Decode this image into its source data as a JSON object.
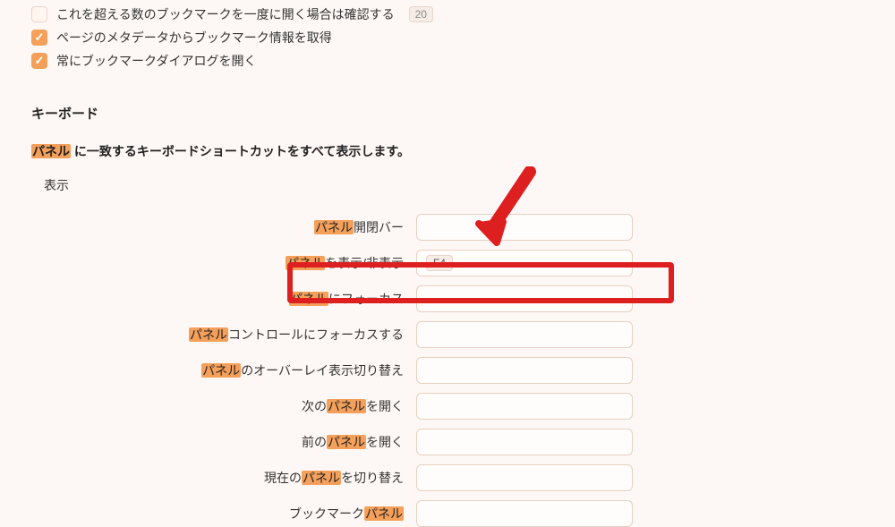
{
  "checkboxes": {
    "confirm_open": {
      "label": "これを超える数のブックマークを一度に開く場合は確認する",
      "value": "20",
      "checked": false
    },
    "metadata": {
      "label": "ページのメタデータからブックマーク情報を取得",
      "checked": true
    },
    "always_dialog": {
      "label": "常にブックマークダイアログを開く",
      "checked": true
    }
  },
  "section_keyboard": "キーボード",
  "filter": {
    "highlight": "パネル",
    "suffix": " に一致するキーボードショートカットをすべて表示します。"
  },
  "subsection_display": "表示",
  "shortcuts": [
    {
      "hl": "パネル",
      "suffix": "開閉バー",
      "key": ""
    },
    {
      "hl": "パネル",
      "suffix": "を表示/非表示",
      "key": "F4"
    },
    {
      "hl": "パネル",
      "suffix": "にフォーカス",
      "key": ""
    },
    {
      "hl": "パネル",
      "suffix": "コントロールにフォーカスする",
      "key": ""
    },
    {
      "hl": "パネル",
      "suffix": "のオーバーレイ表示切り替え",
      "key": ""
    },
    {
      "prefix": "次の",
      "hl": "パネル",
      "suffix": "を開く",
      "key": ""
    },
    {
      "prefix": "前の",
      "hl": "パネル",
      "suffix": "を開く",
      "key": ""
    },
    {
      "prefix": "現在の",
      "hl": "パネル",
      "suffix": "を切り替え",
      "key": ""
    },
    {
      "prefix": "ブックマーク",
      "hl": "パネル",
      "suffix": "",
      "key": ""
    }
  ]
}
